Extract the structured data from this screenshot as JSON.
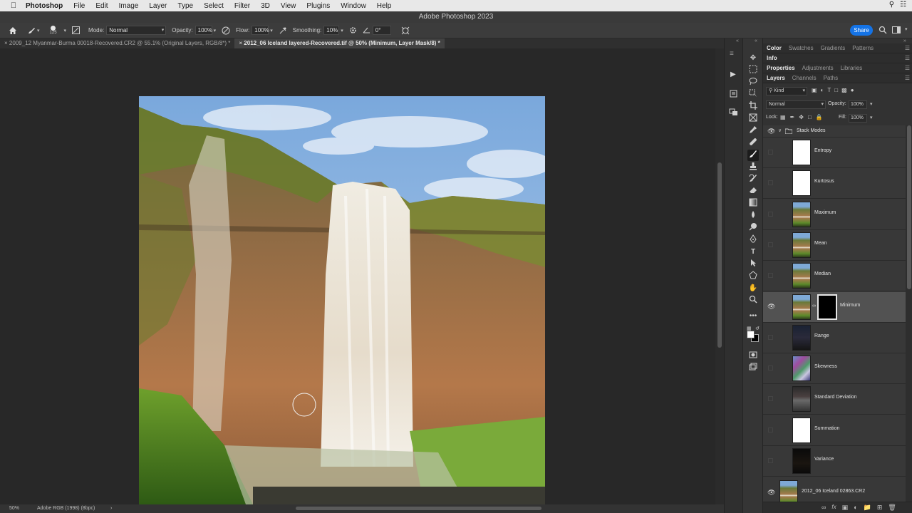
{
  "menubar": {
    "items": [
      "Photoshop",
      "File",
      "Edit",
      "Image",
      "Layer",
      "Type",
      "Select",
      "Filter",
      "3D",
      "View",
      "Plugins",
      "Window",
      "Help"
    ]
  },
  "window": {
    "title": "Adobe Photoshop 2023"
  },
  "options": {
    "brush_size": "125",
    "mode_label": "Mode:",
    "mode_value": "Normal",
    "opacity_label": "Opacity:",
    "opacity_value": "100%",
    "flow_label": "Flow:",
    "flow_value": "100%",
    "smoothing_label": "Smoothing:",
    "smoothing_value": "10%",
    "angle_value": "0°",
    "share_label": "Share"
  },
  "tabs": [
    {
      "label": "2009_12 Myanmar-Burma 00018-Recovered.CR2 @ 55.1% (Original Layers, RGB/8*) *",
      "active": false
    },
    {
      "label": "2012_06 Iceland layered-Recovered.tif @ 50% (Minimum, Layer Mask/8) *",
      "active": true
    }
  ],
  "status": {
    "zoom": "50%",
    "profile": "Adobe RGB (1998) (8bpc)"
  },
  "panels": {
    "row1_tabs": [
      "Color",
      "Swatches",
      "Gradients",
      "Patterns"
    ],
    "row2_tabs": [
      "Info"
    ],
    "row3_tabs": [
      "Properties",
      "Adjustments",
      "Libraries"
    ],
    "row4_tabs": [
      "Layers",
      "Channels",
      "Paths"
    ],
    "filter_kind": "Kind",
    "blend_mode": "Normal",
    "opacity_label": "Opacity:",
    "opacity_value": "100%",
    "lock_label": "Lock:",
    "fill_label": "Fill:",
    "fill_value": "100%"
  },
  "layers": {
    "group_name": "Stack Modes",
    "items": [
      {
        "name": "Entropy",
        "thumb": "white",
        "visible": false
      },
      {
        "name": "Kurtosus",
        "thumb": "white",
        "visible": false
      },
      {
        "name": "Maximum",
        "thumb": "falls",
        "visible": false
      },
      {
        "name": "Mean",
        "thumb": "falls",
        "visible": false
      },
      {
        "name": "Median",
        "thumb": "falls",
        "visible": false
      },
      {
        "name": "Minimum",
        "thumb": "falls",
        "visible": true,
        "selected": true,
        "mask": true
      },
      {
        "name": "Range",
        "thumb": "dark",
        "visible": false
      },
      {
        "name": "Skewness",
        "thumb": "skew",
        "visible": false
      },
      {
        "name": "Standard Deviation",
        "thumb": "std",
        "visible": false
      },
      {
        "name": "Summation",
        "thumb": "white",
        "visible": false
      },
      {
        "name": "Variance",
        "thumb": "var",
        "visible": false
      }
    ],
    "background": {
      "name": "2012_06 Iceland 02863.CR2",
      "visible": true
    }
  }
}
